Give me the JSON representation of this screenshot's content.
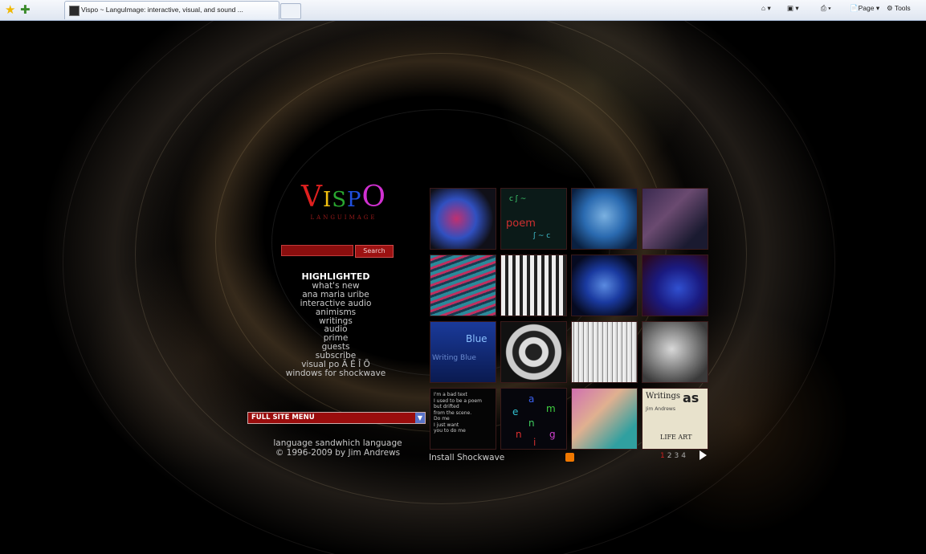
{
  "browser": {
    "tab_title": "Vispo ~ LanguImage: interactive, visual, and sound ...",
    "page_menu": "Page",
    "tools_menu": "Tools"
  },
  "site": {
    "logo_text": "VISPO",
    "logo_subtitle": "LANGUIMAGE",
    "search_button": "Search",
    "search_value": "",
    "menu_heading": "HIGHLIGHTED",
    "menu_items": [
      "what's new",
      "ana maria uribe",
      "interactive audio",
      "animisms",
      "writings",
      "audio",
      "prime",
      "guests",
      "subscribe",
      "visual po Ã É Î Õ",
      "windows for shockwave"
    ],
    "full_site_menu": "FULL SITE MENU",
    "footer_line1": "language sandwhich language",
    "footer_line2": "© 1996-2009 by Jim Andrews",
    "install_link": "Install Shockwave",
    "pages": [
      "1",
      "2",
      "3",
      "4"
    ],
    "current_page": "1",
    "poem_lines": [
      "I'm a bad text",
      "I used to be a poem",
      "but drifted",
      "from the scene.",
      "Do me",
      "I just want",
      "you to do me"
    ],
    "letters": [
      "a",
      "e",
      "m",
      "n",
      "n",
      "i",
      "g"
    ],
    "writings_title": "Writings",
    "writings_logo": "as",
    "writings_author": "Jim Andrews",
    "life_art": "LIFE ART",
    "blue_label": "Blue",
    "blue_text": "Writing Blue"
  }
}
